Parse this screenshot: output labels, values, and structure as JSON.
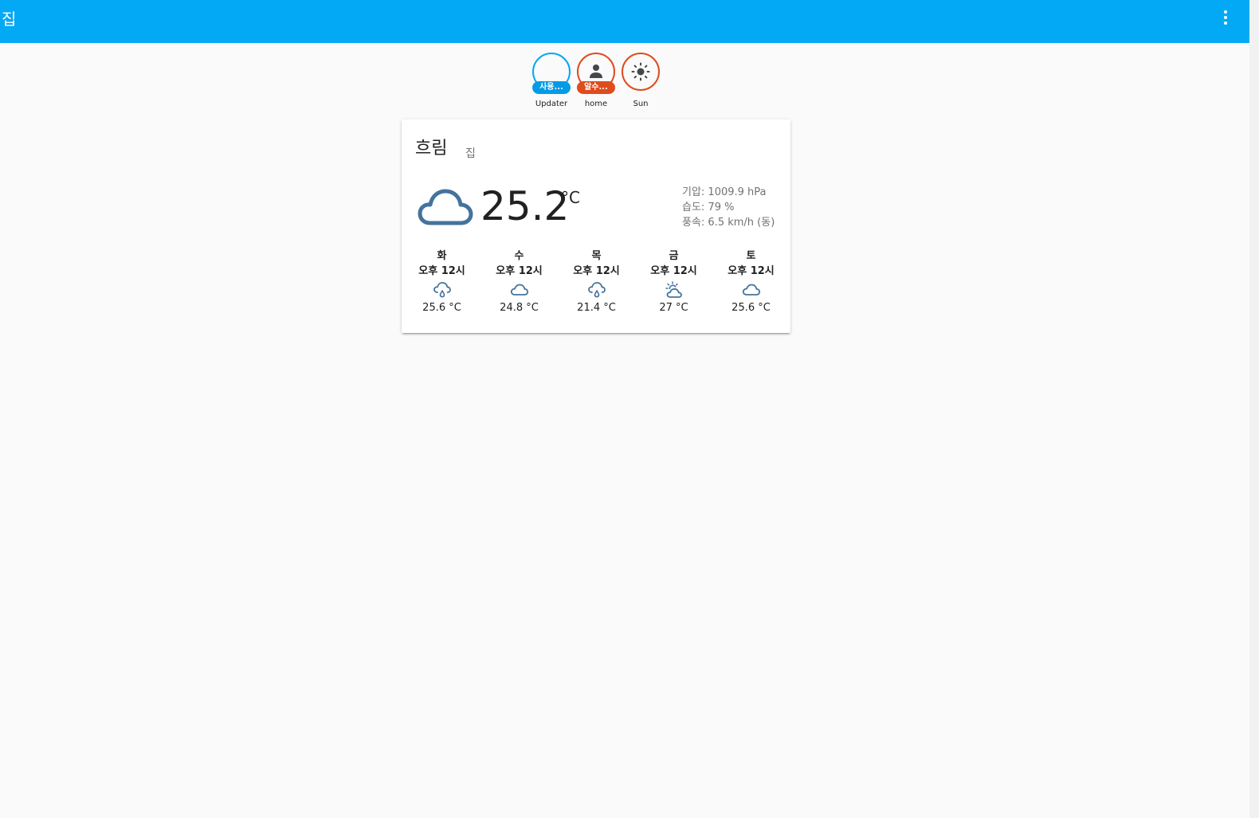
{
  "header": {
    "title": "집",
    "menu_icon": "dots-vertical-icon"
  },
  "badges": [
    {
      "label": "Updater",
      "pill": "사용...",
      "pill_color": "#039be5",
      "ring_color": "#03a9f4",
      "icon": "none"
    },
    {
      "label": "home",
      "pill": "알수...",
      "pill_color": "#df4c1e",
      "ring_color": "#df4c1e",
      "icon": "person-icon"
    },
    {
      "label": "Sun",
      "pill": "",
      "pill_color": "",
      "ring_color": "#df4c1e",
      "icon": "sun-icon"
    }
  ],
  "weather": {
    "condition": "흐림",
    "location": "집",
    "icon": "cloud-icon",
    "temperature": "25.2",
    "unit": "°C",
    "attributes": {
      "pressure": "기압: 1009.9 hPa",
      "humidity": "습도: 79 %",
      "wind": "풍속: 6.5 km/h (동)"
    },
    "forecast": [
      {
        "day": "화",
        "time": "오후 12시",
        "icon": "rain-cloud-icon",
        "temp": "25.6 °C"
      },
      {
        "day": "수",
        "time": "오후 12시",
        "icon": "cloud-icon",
        "temp": "24.8 °C"
      },
      {
        "day": "목",
        "time": "오후 12시",
        "icon": "rain-cloud-icon",
        "temp": "21.4 °C"
      },
      {
        "day": "금",
        "time": "오후 12시",
        "icon": "partly-cloudy-icon",
        "temp": "27 °C"
      },
      {
        "day": "토",
        "time": "오후 12시",
        "icon": "cloud-icon",
        "temp": "25.6 °C"
      }
    ]
  },
  "colors": {
    "header": "#03a9f4",
    "accent_orange": "#df4c1e",
    "weather_icon": "#44739e"
  }
}
